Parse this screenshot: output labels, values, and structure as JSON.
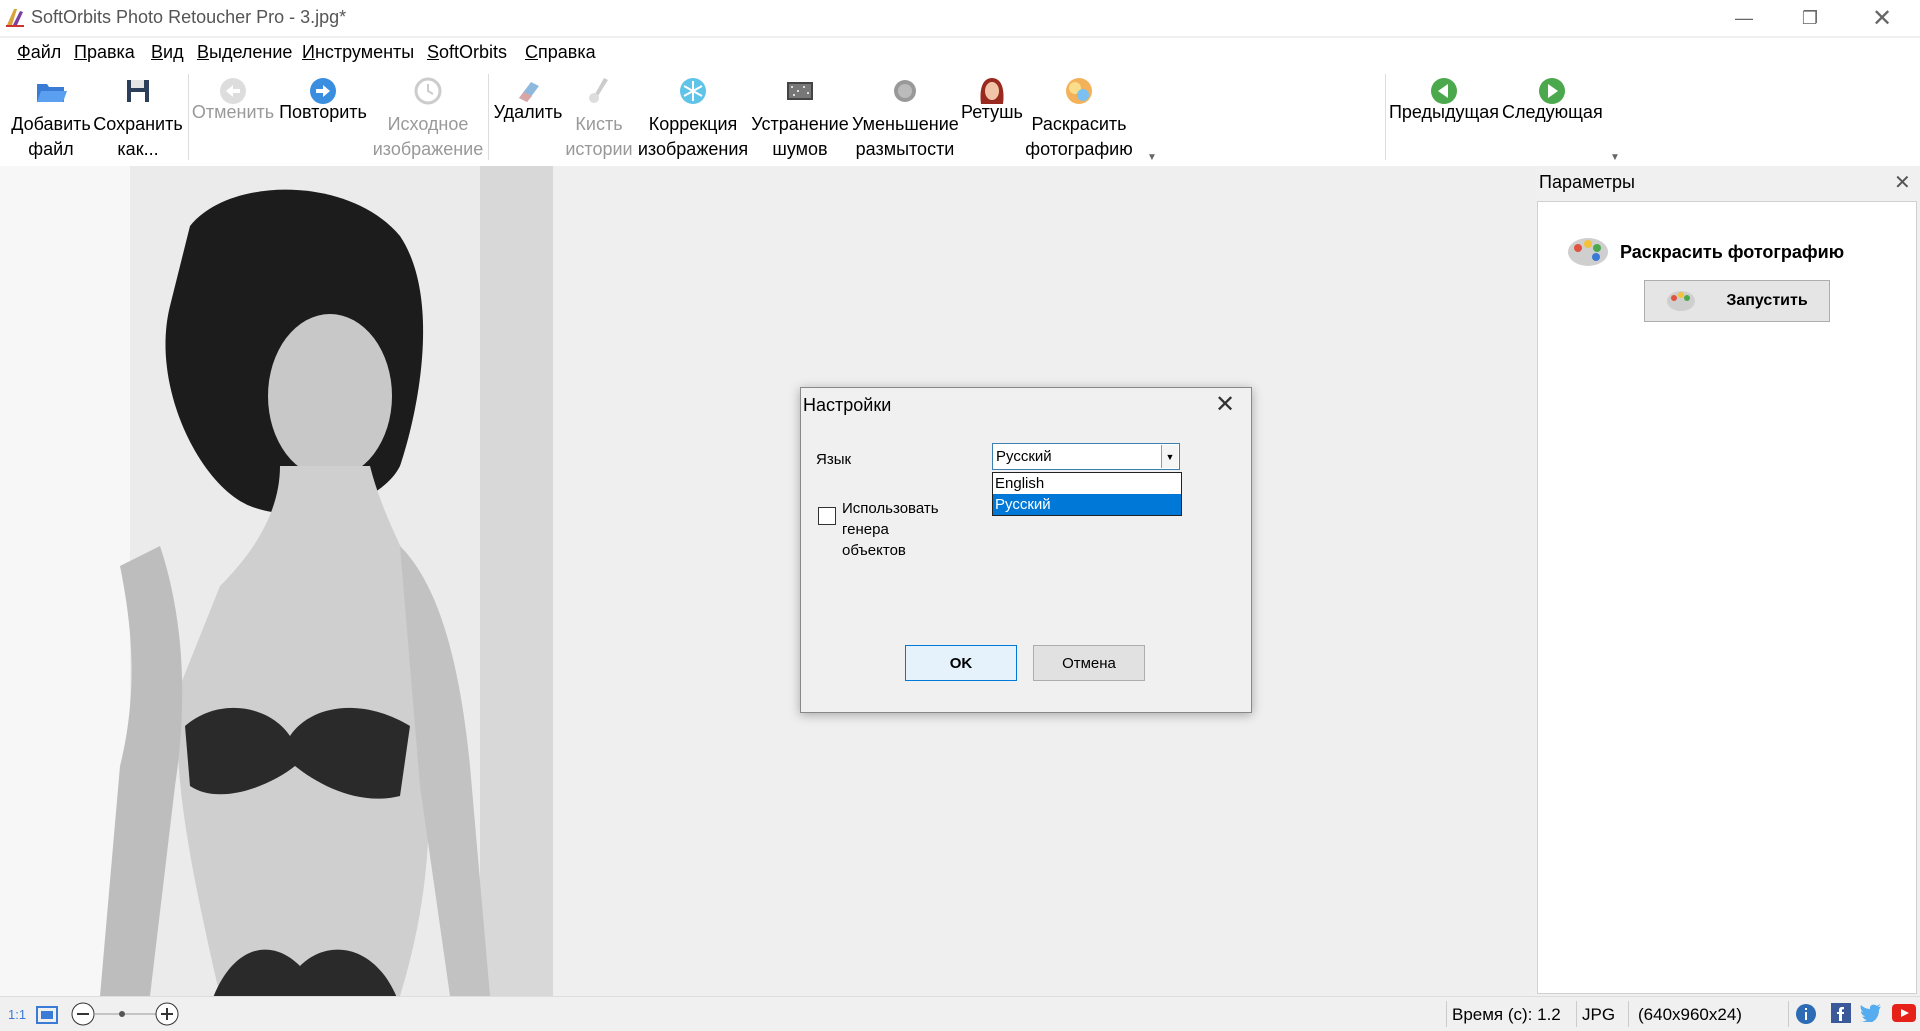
{
  "window": {
    "title": "SoftOrbits Photo Retoucher Pro - 3.jpg*"
  },
  "menu": [
    "Файл",
    "Правка",
    "Вид",
    "Выделение",
    "Инструменты",
    "SoftOrbits",
    "Справка"
  ],
  "toolbar": {
    "add": [
      "Добавить",
      "файл"
    ],
    "save": [
      "Сохранить",
      "как..."
    ],
    "undo": "Отменить",
    "redo": "Повторить",
    "original": [
      "Исходное",
      "изображение"
    ],
    "delete": "Удалить",
    "history": [
      "Кисть",
      "истории"
    ],
    "correction": [
      "Коррекция",
      "изображения"
    ],
    "denoise": [
      "Устранение",
      "шумов"
    ],
    "deblur": [
      "Уменьшение",
      "размытости"
    ],
    "retouch": "Ретушь",
    "colorize": [
      "Раскрасить",
      "фотографию"
    ],
    "prev": "Предыдущая",
    "next": "Следующая"
  },
  "side": {
    "header": "Параметры",
    "title": "Раскрасить фотографию",
    "run": "Запустить"
  },
  "dialog": {
    "title": "Настройки",
    "lang_label": "Язык",
    "lang_value": "Русский",
    "options": [
      "English",
      "Русский"
    ],
    "checkbox_text": "Использовать генера",
    "checkbox_text2": "объектов",
    "ok": "OK",
    "cancel": "Отмена"
  },
  "status": {
    "zoom_label": "1:1",
    "time": "Время (с): 1.2",
    "format": "JPG",
    "dims": "(640x960x24)"
  },
  "colors": {
    "accent": "#0078d7",
    "toolbar_bg": "#ffffff",
    "window_bg": "#f0f0f0"
  }
}
